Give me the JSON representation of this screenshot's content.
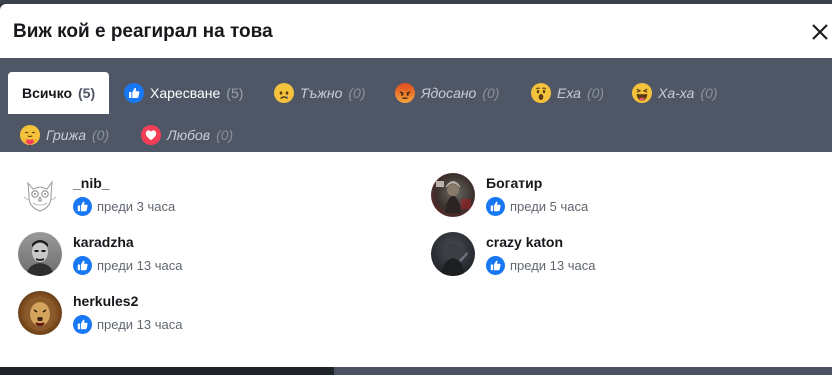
{
  "modal": {
    "title": "Виж кой е реагирал на това",
    "close_icon": "close-icon"
  },
  "tabs": [
    {
      "label": "Всичко",
      "count": "(5)",
      "icon": null
    },
    {
      "label": "Харесване",
      "count": "(5)",
      "icon": "like-icon"
    },
    {
      "label": "Тъжно",
      "count": "(0)",
      "icon": "sad-icon"
    },
    {
      "label": "Ядосано",
      "count": "(0)",
      "icon": "angry-icon"
    },
    {
      "label": "Еха",
      "count": "(0)",
      "icon": "wow-icon"
    },
    {
      "label": "Ха-ха",
      "count": "(0)",
      "icon": "haha-icon"
    },
    {
      "label": "Грижа",
      "count": "(0)",
      "icon": "care-icon"
    },
    {
      "label": "Любов",
      "count": "(0)",
      "icon": "love-icon"
    }
  ],
  "users": [
    {
      "name": "_nib_",
      "time": "преди 3 часа",
      "reaction": "like-icon"
    },
    {
      "name": "Богатир",
      "time": "преди 5 часа",
      "reaction": "like-icon"
    },
    {
      "name": "karadzha",
      "time": "преди 13 часа",
      "reaction": "like-icon"
    },
    {
      "name": "crazy katon",
      "time": "преди 13 часа",
      "reaction": "like-icon"
    },
    {
      "name": "herkules2",
      "time": "преди 13 часа",
      "reaction": "like-icon"
    }
  ],
  "colors": {
    "like_blue": "#1877f2",
    "tabs_background": "#4f5767",
    "emoji_yellow": "#f5c33b",
    "angry_orange": "#e9710f",
    "love_red": "#f33e58"
  }
}
